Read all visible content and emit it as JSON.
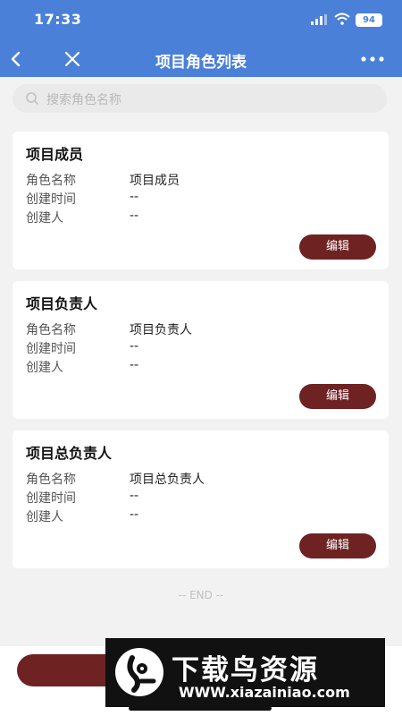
{
  "status": {
    "time": "17:33",
    "battery": "94",
    "icons": [
      "signal-icon",
      "wifi-icon",
      "battery-icon"
    ]
  },
  "header": {
    "title": "项目角色列表",
    "back_icon": "chevron-left-icon",
    "close_icon": "close-icon",
    "more_icon": "more-icon"
  },
  "search": {
    "placeholder": "搜索角色名称"
  },
  "labels": {
    "name": "角色名称",
    "created_time": "创建时间",
    "creator": "创建人"
  },
  "roles": [
    {
      "title": "项目成员",
      "name": "项目成员",
      "created_time": "--",
      "creator": "--",
      "edit_label": "编辑"
    },
    {
      "title": "项目负责人",
      "name": "项目负责人",
      "created_time": "--",
      "creator": "--",
      "edit_label": "编辑"
    },
    {
      "title": "项目总负责人",
      "name": "项目总负责人",
      "created_time": "--",
      "creator": "--",
      "edit_label": "编辑"
    }
  ],
  "end_text": "-- END --",
  "watermark": {
    "title": "下载鸟资源",
    "url": "WWW.xiazainiao.com"
  },
  "colors": {
    "primary": "#4a80d8",
    "button": "#6e2222",
    "background": "#f2f2f2"
  }
}
